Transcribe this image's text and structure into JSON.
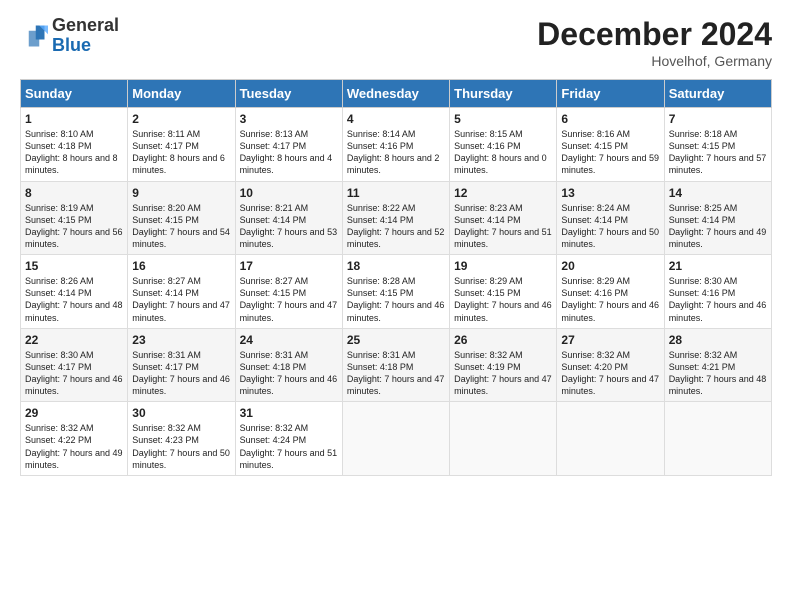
{
  "header": {
    "logo_general": "General",
    "logo_blue": "Blue",
    "title": "December 2024",
    "location": "Hovelhof, Germany"
  },
  "days_of_week": [
    "Sunday",
    "Monday",
    "Tuesday",
    "Wednesday",
    "Thursday",
    "Friday",
    "Saturday"
  ],
  "weeks": [
    [
      {
        "day": "1",
        "sunrise": "Sunrise: 8:10 AM",
        "sunset": "Sunset: 4:18 PM",
        "daylight": "Daylight: 8 hours and 8 minutes."
      },
      {
        "day": "2",
        "sunrise": "Sunrise: 8:11 AM",
        "sunset": "Sunset: 4:17 PM",
        "daylight": "Daylight: 8 hours and 6 minutes."
      },
      {
        "day": "3",
        "sunrise": "Sunrise: 8:13 AM",
        "sunset": "Sunset: 4:17 PM",
        "daylight": "Daylight: 8 hours and 4 minutes."
      },
      {
        "day": "4",
        "sunrise": "Sunrise: 8:14 AM",
        "sunset": "Sunset: 4:16 PM",
        "daylight": "Daylight: 8 hours and 2 minutes."
      },
      {
        "day": "5",
        "sunrise": "Sunrise: 8:15 AM",
        "sunset": "Sunset: 4:16 PM",
        "daylight": "Daylight: 8 hours and 0 minutes."
      },
      {
        "day": "6",
        "sunrise": "Sunrise: 8:16 AM",
        "sunset": "Sunset: 4:15 PM",
        "daylight": "Daylight: 7 hours and 59 minutes."
      },
      {
        "day": "7",
        "sunrise": "Sunrise: 8:18 AM",
        "sunset": "Sunset: 4:15 PM",
        "daylight": "Daylight: 7 hours and 57 minutes."
      }
    ],
    [
      {
        "day": "8",
        "sunrise": "Sunrise: 8:19 AM",
        "sunset": "Sunset: 4:15 PM",
        "daylight": "Daylight: 7 hours and 56 minutes."
      },
      {
        "day": "9",
        "sunrise": "Sunrise: 8:20 AM",
        "sunset": "Sunset: 4:15 PM",
        "daylight": "Daylight: 7 hours and 54 minutes."
      },
      {
        "day": "10",
        "sunrise": "Sunrise: 8:21 AM",
        "sunset": "Sunset: 4:14 PM",
        "daylight": "Daylight: 7 hours and 53 minutes."
      },
      {
        "day": "11",
        "sunrise": "Sunrise: 8:22 AM",
        "sunset": "Sunset: 4:14 PM",
        "daylight": "Daylight: 7 hours and 52 minutes."
      },
      {
        "day": "12",
        "sunrise": "Sunrise: 8:23 AM",
        "sunset": "Sunset: 4:14 PM",
        "daylight": "Daylight: 7 hours and 51 minutes."
      },
      {
        "day": "13",
        "sunrise": "Sunrise: 8:24 AM",
        "sunset": "Sunset: 4:14 PM",
        "daylight": "Daylight: 7 hours and 50 minutes."
      },
      {
        "day": "14",
        "sunrise": "Sunrise: 8:25 AM",
        "sunset": "Sunset: 4:14 PM",
        "daylight": "Daylight: 7 hours and 49 minutes."
      }
    ],
    [
      {
        "day": "15",
        "sunrise": "Sunrise: 8:26 AM",
        "sunset": "Sunset: 4:14 PM",
        "daylight": "Daylight: 7 hours and 48 minutes."
      },
      {
        "day": "16",
        "sunrise": "Sunrise: 8:27 AM",
        "sunset": "Sunset: 4:14 PM",
        "daylight": "Daylight: 7 hours and 47 minutes."
      },
      {
        "day": "17",
        "sunrise": "Sunrise: 8:27 AM",
        "sunset": "Sunset: 4:15 PM",
        "daylight": "Daylight: 7 hours and 47 minutes."
      },
      {
        "day": "18",
        "sunrise": "Sunrise: 8:28 AM",
        "sunset": "Sunset: 4:15 PM",
        "daylight": "Daylight: 7 hours and 46 minutes."
      },
      {
        "day": "19",
        "sunrise": "Sunrise: 8:29 AM",
        "sunset": "Sunset: 4:15 PM",
        "daylight": "Daylight: 7 hours and 46 minutes."
      },
      {
        "day": "20",
        "sunrise": "Sunrise: 8:29 AM",
        "sunset": "Sunset: 4:16 PM",
        "daylight": "Daylight: 7 hours and 46 minutes."
      },
      {
        "day": "21",
        "sunrise": "Sunrise: 8:30 AM",
        "sunset": "Sunset: 4:16 PM",
        "daylight": "Daylight: 7 hours and 46 minutes."
      }
    ],
    [
      {
        "day": "22",
        "sunrise": "Sunrise: 8:30 AM",
        "sunset": "Sunset: 4:17 PM",
        "daylight": "Daylight: 7 hours and 46 minutes."
      },
      {
        "day": "23",
        "sunrise": "Sunrise: 8:31 AM",
        "sunset": "Sunset: 4:17 PM",
        "daylight": "Daylight: 7 hours and 46 minutes."
      },
      {
        "day": "24",
        "sunrise": "Sunrise: 8:31 AM",
        "sunset": "Sunset: 4:18 PM",
        "daylight": "Daylight: 7 hours and 46 minutes."
      },
      {
        "day": "25",
        "sunrise": "Sunrise: 8:31 AM",
        "sunset": "Sunset: 4:18 PM",
        "daylight": "Daylight: 7 hours and 47 minutes."
      },
      {
        "day": "26",
        "sunrise": "Sunrise: 8:32 AM",
        "sunset": "Sunset: 4:19 PM",
        "daylight": "Daylight: 7 hours and 47 minutes."
      },
      {
        "day": "27",
        "sunrise": "Sunrise: 8:32 AM",
        "sunset": "Sunset: 4:20 PM",
        "daylight": "Daylight: 7 hours and 47 minutes."
      },
      {
        "day": "28",
        "sunrise": "Sunrise: 8:32 AM",
        "sunset": "Sunset: 4:21 PM",
        "daylight": "Daylight: 7 hours and 48 minutes."
      }
    ],
    [
      {
        "day": "29",
        "sunrise": "Sunrise: 8:32 AM",
        "sunset": "Sunset: 4:22 PM",
        "daylight": "Daylight: 7 hours and 49 minutes."
      },
      {
        "day": "30",
        "sunrise": "Sunrise: 8:32 AM",
        "sunset": "Sunset: 4:23 PM",
        "daylight": "Daylight: 7 hours and 50 minutes."
      },
      {
        "day": "31",
        "sunrise": "Sunrise: 8:32 AM",
        "sunset": "Sunset: 4:24 PM",
        "daylight": "Daylight: 7 hours and 51 minutes."
      },
      null,
      null,
      null,
      null
    ]
  ]
}
